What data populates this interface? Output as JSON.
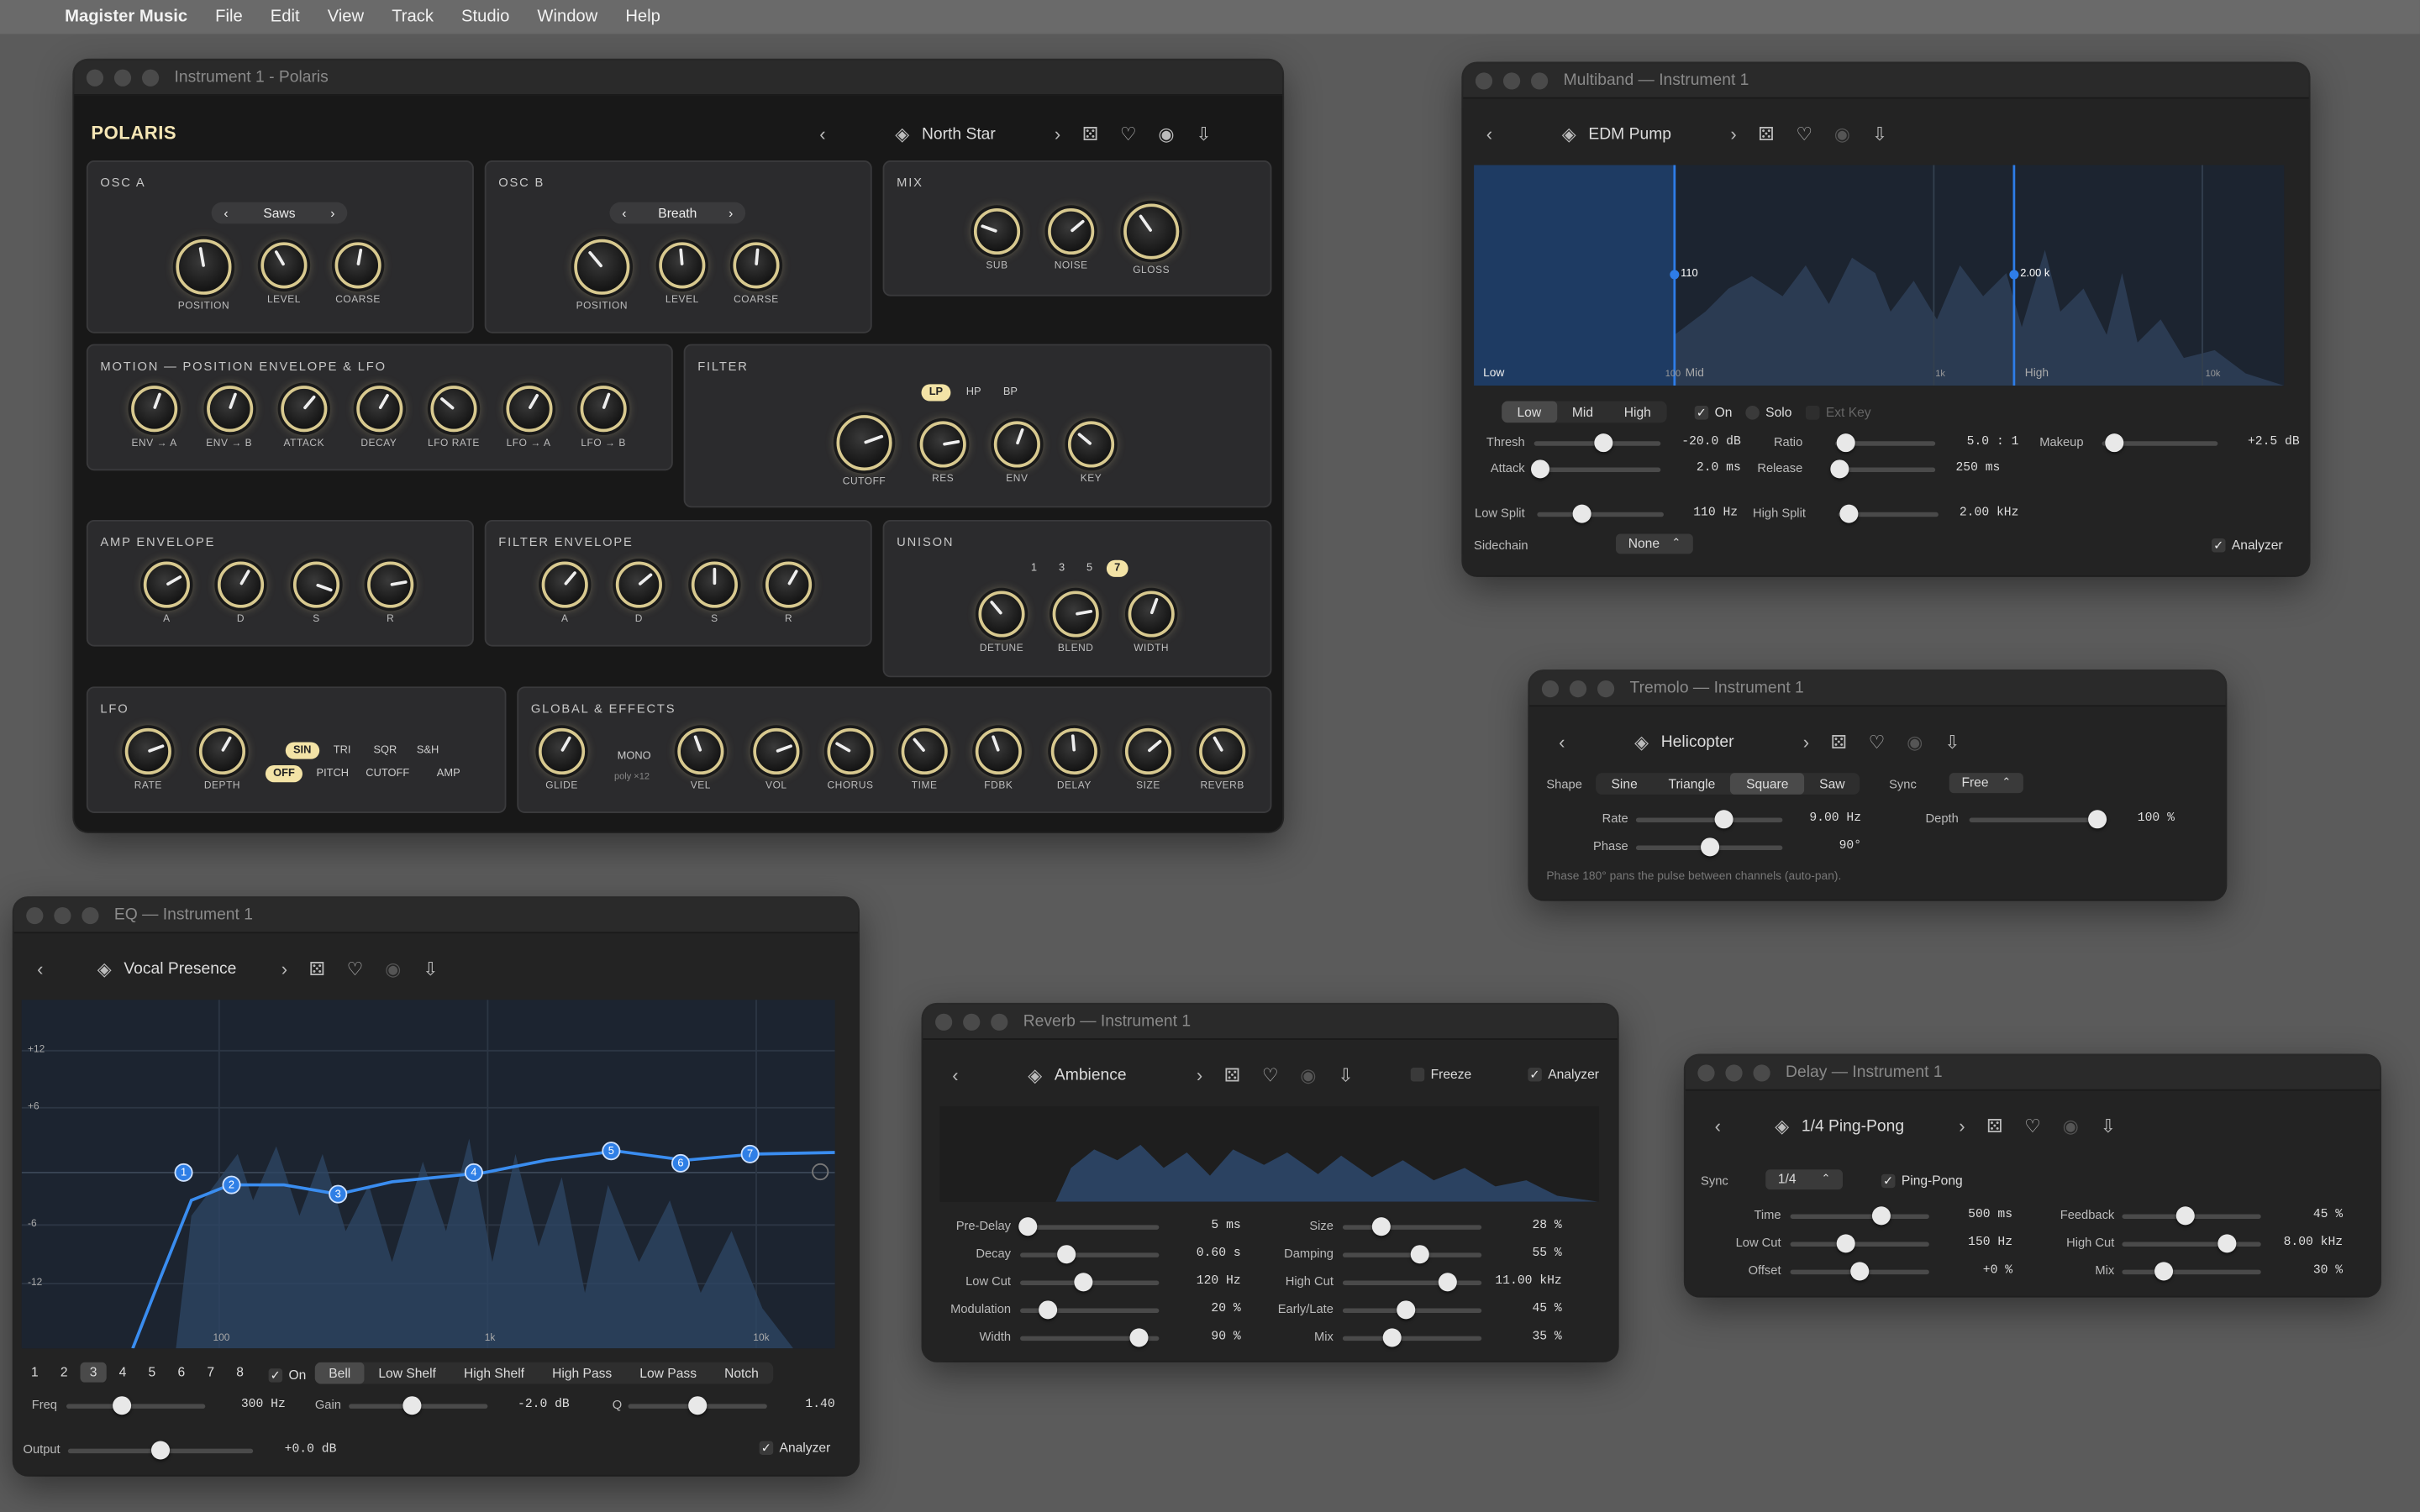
{
  "menubar": {
    "app": "Magister Music",
    "items": [
      "File",
      "Edit",
      "View",
      "Track",
      "Studio",
      "Window",
      "Help"
    ]
  },
  "polaris": {
    "title": "Instrument 1 - Polaris",
    "logo": "POLARIS",
    "preset": "North Star",
    "osc_a": {
      "title": "OSC A",
      "wave": "Saws",
      "knobs": [
        "POSITION",
        "LEVEL",
        "COARSE"
      ]
    },
    "osc_b": {
      "title": "OSC B",
      "wave": "Breath",
      "knobs": [
        "POSITION",
        "LEVEL",
        "COARSE"
      ]
    },
    "mix": {
      "title": "MIX",
      "knobs": [
        "SUB",
        "NOISE",
        "GLOSS"
      ]
    },
    "motion": {
      "title": "MOTION — POSITION ENVELOPE & LFO",
      "knobs": [
        "ENV → A",
        "ENV → B",
        "ATTACK",
        "DECAY",
        "LFO RATE",
        "LFO → A",
        "LFO → B"
      ]
    },
    "filter": {
      "title": "FILTER",
      "modes": [
        "LP",
        "HP",
        "BP"
      ],
      "active_mode": "LP",
      "knobs": [
        "CUTOFF",
        "RES",
        "ENV",
        "KEY"
      ]
    },
    "amp_env": {
      "title": "AMP ENVELOPE",
      "knobs": [
        "A",
        "D",
        "S",
        "R"
      ]
    },
    "filter_env": {
      "title": "FILTER ENVELOPE",
      "knobs": [
        "A",
        "D",
        "S",
        "R"
      ]
    },
    "unison": {
      "title": "UNISON",
      "voices": [
        "1",
        "3",
        "5",
        "7"
      ],
      "active_voice": "7",
      "knobs": [
        "DETUNE",
        "BLEND",
        "WIDTH"
      ]
    },
    "lfo": {
      "title": "LFO",
      "knobs": [
        "RATE",
        "DEPTH"
      ],
      "shapes": [
        "SIN",
        "TRI",
        "SQR",
        "S&H"
      ],
      "targets": [
        "OFF",
        "PITCH",
        "CUTOFF",
        "AMP"
      ],
      "active_shape": "SIN",
      "active_target": "OFF"
    },
    "global": {
      "title": "GLOBAL & EFFECTS",
      "mono": "MONO",
      "poly": "poly ×12",
      "knobs": [
        "GLIDE",
        "VEL",
        "VOL",
        "CHORUS",
        "TIME",
        "FDBK",
        "DELAY",
        "SIZE",
        "REVERB"
      ]
    }
  },
  "multiband": {
    "title": "Multiband — Instrument 1",
    "preset": "EDM Pump",
    "markers": [
      "110",
      "2.00 k"
    ],
    "band_labels": [
      "Low",
      "Mid",
      "High"
    ],
    "freq_labels": [
      "100",
      "1k",
      "10k"
    ],
    "bands": [
      "Low",
      "Mid",
      "High"
    ],
    "active_band": "Low",
    "on": "On",
    "solo": "Solo",
    "ext_key": "Ext Key",
    "thresh": {
      "label": "Thresh",
      "value": "-20.0 dB",
      "pos": 0.55
    },
    "ratio": {
      "label": "Ratio",
      "value": "5.0 : 1",
      "pos": 0.1
    },
    "makeup": {
      "label": "Makeup",
      "value": "+2.5 dB",
      "pos": 0.1
    },
    "attack": {
      "label": "Attack",
      "value": "2.0 ms",
      "pos": 0.05
    },
    "release": {
      "label": "Release",
      "value": "250 ms",
      "pos": 0.05
    },
    "low_split": {
      "label": "Low Split",
      "value": "110 Hz",
      "pos": 0.35
    },
    "high_split": {
      "label": "High Split",
      "value": "2.00 kHz",
      "pos": 0.1
    },
    "sidechain": {
      "label": "Sidechain",
      "value": "None"
    },
    "analyzer": "Analyzer"
  },
  "tremolo": {
    "title": "Tremolo — Instrument 1",
    "preset": "Helicopter",
    "shape_label": "Shape",
    "shapes": [
      "Sine",
      "Triangle",
      "Square",
      "Saw"
    ],
    "active_shape": "Square",
    "sync_label": "Sync",
    "sync": "Free",
    "rate": {
      "label": "Rate",
      "value": "9.00 Hz",
      "pos": 0.6
    },
    "depth": {
      "label": "Depth",
      "value": "100 %",
      "pos": 0.95
    },
    "phase": {
      "label": "Phase",
      "value": "90°",
      "pos": 0.5
    },
    "note": "Phase 180° pans the pulse between channels (auto-pan)."
  },
  "eq": {
    "title": "EQ — Instrument 1",
    "preset": "Vocal Presence",
    "db_labels": [
      "+12",
      "+6",
      "-6",
      "-12"
    ],
    "freq_labels": [
      "100",
      "1k",
      "10k"
    ],
    "bands": [
      "1",
      "2",
      "3",
      "4",
      "5",
      "6",
      "7",
      "8"
    ],
    "active_band": "3",
    "on": "On",
    "types": [
      "Bell",
      "Low Shelf",
      "High Shelf",
      "High Pass",
      "Low Pass",
      "Notch"
    ],
    "active_type": "Bell",
    "freq": {
      "label": "Freq",
      "value": "300 Hz",
      "pos": 0.4
    },
    "gain": {
      "label": "Gain",
      "value": "-2.0 dB",
      "pos": 0.45
    },
    "q": {
      "label": "Q",
      "value": "1.40",
      "pos": 0.5
    },
    "output": {
      "label": "Output",
      "value": "+0.0 dB",
      "pos": 0.5
    },
    "analyzer": "Analyzer"
  },
  "reverb": {
    "title": "Reverb — Instrument 1",
    "preset": "Ambience",
    "freeze": "Freeze",
    "analyzer": "Analyzer",
    "left": [
      {
        "label": "Pre-Delay",
        "value": "5 ms",
        "pos": 0.05
      },
      {
        "label": "Decay",
        "value": "0.60 s",
        "pos": 0.33
      },
      {
        "label": "Low Cut",
        "value": "120 Hz",
        "pos": 0.45
      },
      {
        "label": "Modulation",
        "value": "20 %",
        "pos": 0.2
      },
      {
        "label": "Width",
        "value": "90 %",
        "pos": 0.85
      }
    ],
    "right": [
      {
        "label": "Size",
        "value": "28 %",
        "pos": 0.28
      },
      {
        "label": "Damping",
        "value": "55 %",
        "pos": 0.55
      },
      {
        "label": "High Cut",
        "value": "11.00 kHz",
        "pos": 0.75
      },
      {
        "label": "Early/Late",
        "value": "45 %",
        "pos": 0.45
      },
      {
        "label": "Mix",
        "value": "35 %",
        "pos": 0.35
      }
    ]
  },
  "delay": {
    "title": "Delay — Instrument 1",
    "preset": "1/4 Ping-Pong",
    "sync_label": "Sync",
    "sync": "1/4",
    "pingpong": "Ping-Pong",
    "left": [
      {
        "label": "Time",
        "value": "500 ms",
        "pos": 0.65
      },
      {
        "label": "Low Cut",
        "value": "150 Hz",
        "pos": 0.4
      },
      {
        "label": "Offset",
        "value": "+0 %",
        "pos": 0.5
      }
    ],
    "right": [
      {
        "label": "Feedback",
        "value": "45 %",
        "pos": 0.45
      },
      {
        "label": "High Cut",
        "value": "8.00 kHz",
        "pos": 0.75
      },
      {
        "label": "Mix",
        "value": "30 %",
        "pos": 0.3
      }
    ]
  }
}
